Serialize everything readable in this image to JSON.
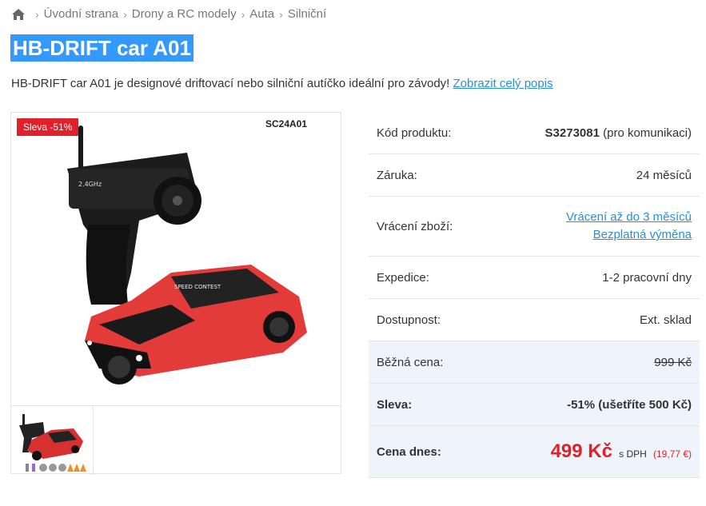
{
  "breadcrumb": {
    "items": [
      "Úvodní strana",
      "Drony a RC modely",
      "Auta",
      "Silniční"
    ]
  },
  "product": {
    "title": "HB-DRIFT car A01",
    "description": "HB-DRIFT car A01 je designové driftovací nebo silniční autíčko ideální pro závody!",
    "description_link": "Zobrazit celý popis"
  },
  "gallery": {
    "badge": "Sleva -51%",
    "image_label": "SC24A01",
    "remote_label": "2.4GHz",
    "car_text": "SPEED CONTEST"
  },
  "specs": {
    "code_label": "Kód produktu:",
    "code_value": "S3273081",
    "code_note": "(pro komunikaci)",
    "warranty_label": "Záruka:",
    "warranty_value": "24 měsíců",
    "return_label": "Vrácení zboží:",
    "return_link1": "Vrácení až do 3 měsíců",
    "return_link2": "Bezplatná výměna",
    "dispatch_label": "Expedice:",
    "dispatch_value": "1-2 pracovní dny",
    "availability_label": "Dostupnost:",
    "availability_value": "Ext. sklad"
  },
  "pricing": {
    "regular_label": "Běžná cena:",
    "regular_value": "999 Kč",
    "discount_label": "Sleva:",
    "discount_value": "-51% (ušetříte 500 Kč)",
    "today_label": "Cena dnes:",
    "today_value": "499 Kč",
    "vat_note": "s DPH",
    "eur_value": "(19,77 €)"
  },
  "colors": {
    "accent_blue": "#3399ff",
    "link": "#2a8fd6",
    "sale_red": "#e0202a"
  }
}
